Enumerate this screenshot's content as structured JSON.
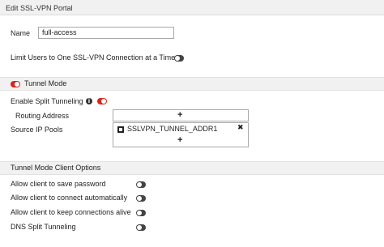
{
  "window": {
    "title": "Edit SSL-VPN Portal"
  },
  "name_field": {
    "label": "Name",
    "value": "full-access"
  },
  "limit_users": {
    "label": "Limit Users to One SSL-VPN Connection at a Time",
    "enabled": false
  },
  "tunnel_mode": {
    "label": "Tunnel Mode",
    "enabled": true,
    "split_tunneling": {
      "label": "Enable Split Tunneling",
      "info_icon": "info-icon",
      "enabled": true
    },
    "routing_address": {
      "label": "Routing Address",
      "add_symbol": "+"
    },
    "source_ip_pools": {
      "label": "Source IP Pools",
      "entries": [
        {
          "name": "SSLVPN_TUNNEL_ADDR1",
          "icon": "address-object-icon",
          "remove_symbol": "✖"
        }
      ],
      "add_symbol": "+"
    }
  },
  "client_options": {
    "label": "Tunnel Mode Client Options",
    "items": [
      {
        "label": "Allow client to save password",
        "enabled": false
      },
      {
        "label": "Allow client to connect automatically",
        "enabled": false
      },
      {
        "label": "Allow client to keep connections alive",
        "enabled": false
      },
      {
        "label": "DNS Split Tunneling",
        "enabled": false
      }
    ]
  },
  "colors": {
    "toggle_on": "#d9251c",
    "toggle_off": "#444444",
    "section_bg": "#f1f1f1"
  }
}
